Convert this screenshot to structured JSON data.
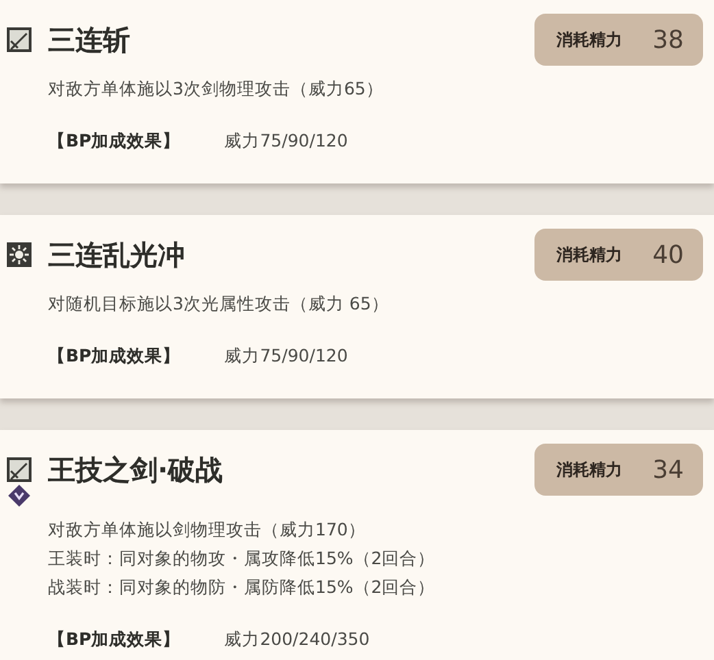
{
  "skills": [
    {
      "icons": [
        {
          "kind": "sword"
        }
      ],
      "name": "三连斩",
      "cost_label": "消耗精力",
      "cost": "38",
      "lines": [
        "对敌方单体施以3次剑物理攻击（威力65）"
      ],
      "bp_label": "【BP加成效果】",
      "bp_value": "威力75/90/120"
    },
    {
      "icons": [
        {
          "kind": "light"
        }
      ],
      "name": "三连乱光冲",
      "cost_label": "消耗精力",
      "cost": "40",
      "lines": [
        "对随机目标施以3次光属性攻击（威力 65）"
      ],
      "bp_label": "【BP加成效果】",
      "bp_value": "威力75/90/120"
    },
    {
      "icons": [
        {
          "kind": "sword"
        },
        {
          "kind": "diamond"
        }
      ],
      "name": "王技之剑·破战",
      "cost_label": "消耗精力",
      "cost": "34",
      "lines": [
        "对敌方单体施以剑物理攻击（威力170）",
        "王装时：同对象的物攻・属攻降低15%（2回合）",
        "战装时：同对象的物防・属防降低15%（2回合）"
      ],
      "bp_label": "【BP加成效果】",
      "bp_value": "威力200/240/350"
    }
  ]
}
